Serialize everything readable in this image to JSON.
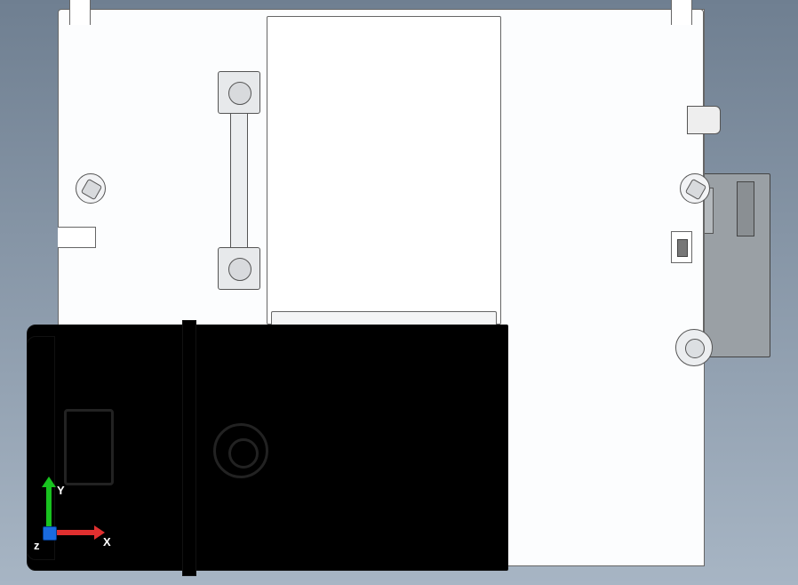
{
  "triad": {
    "x_label": "X",
    "y_label": "Y",
    "z_label": "z"
  }
}
